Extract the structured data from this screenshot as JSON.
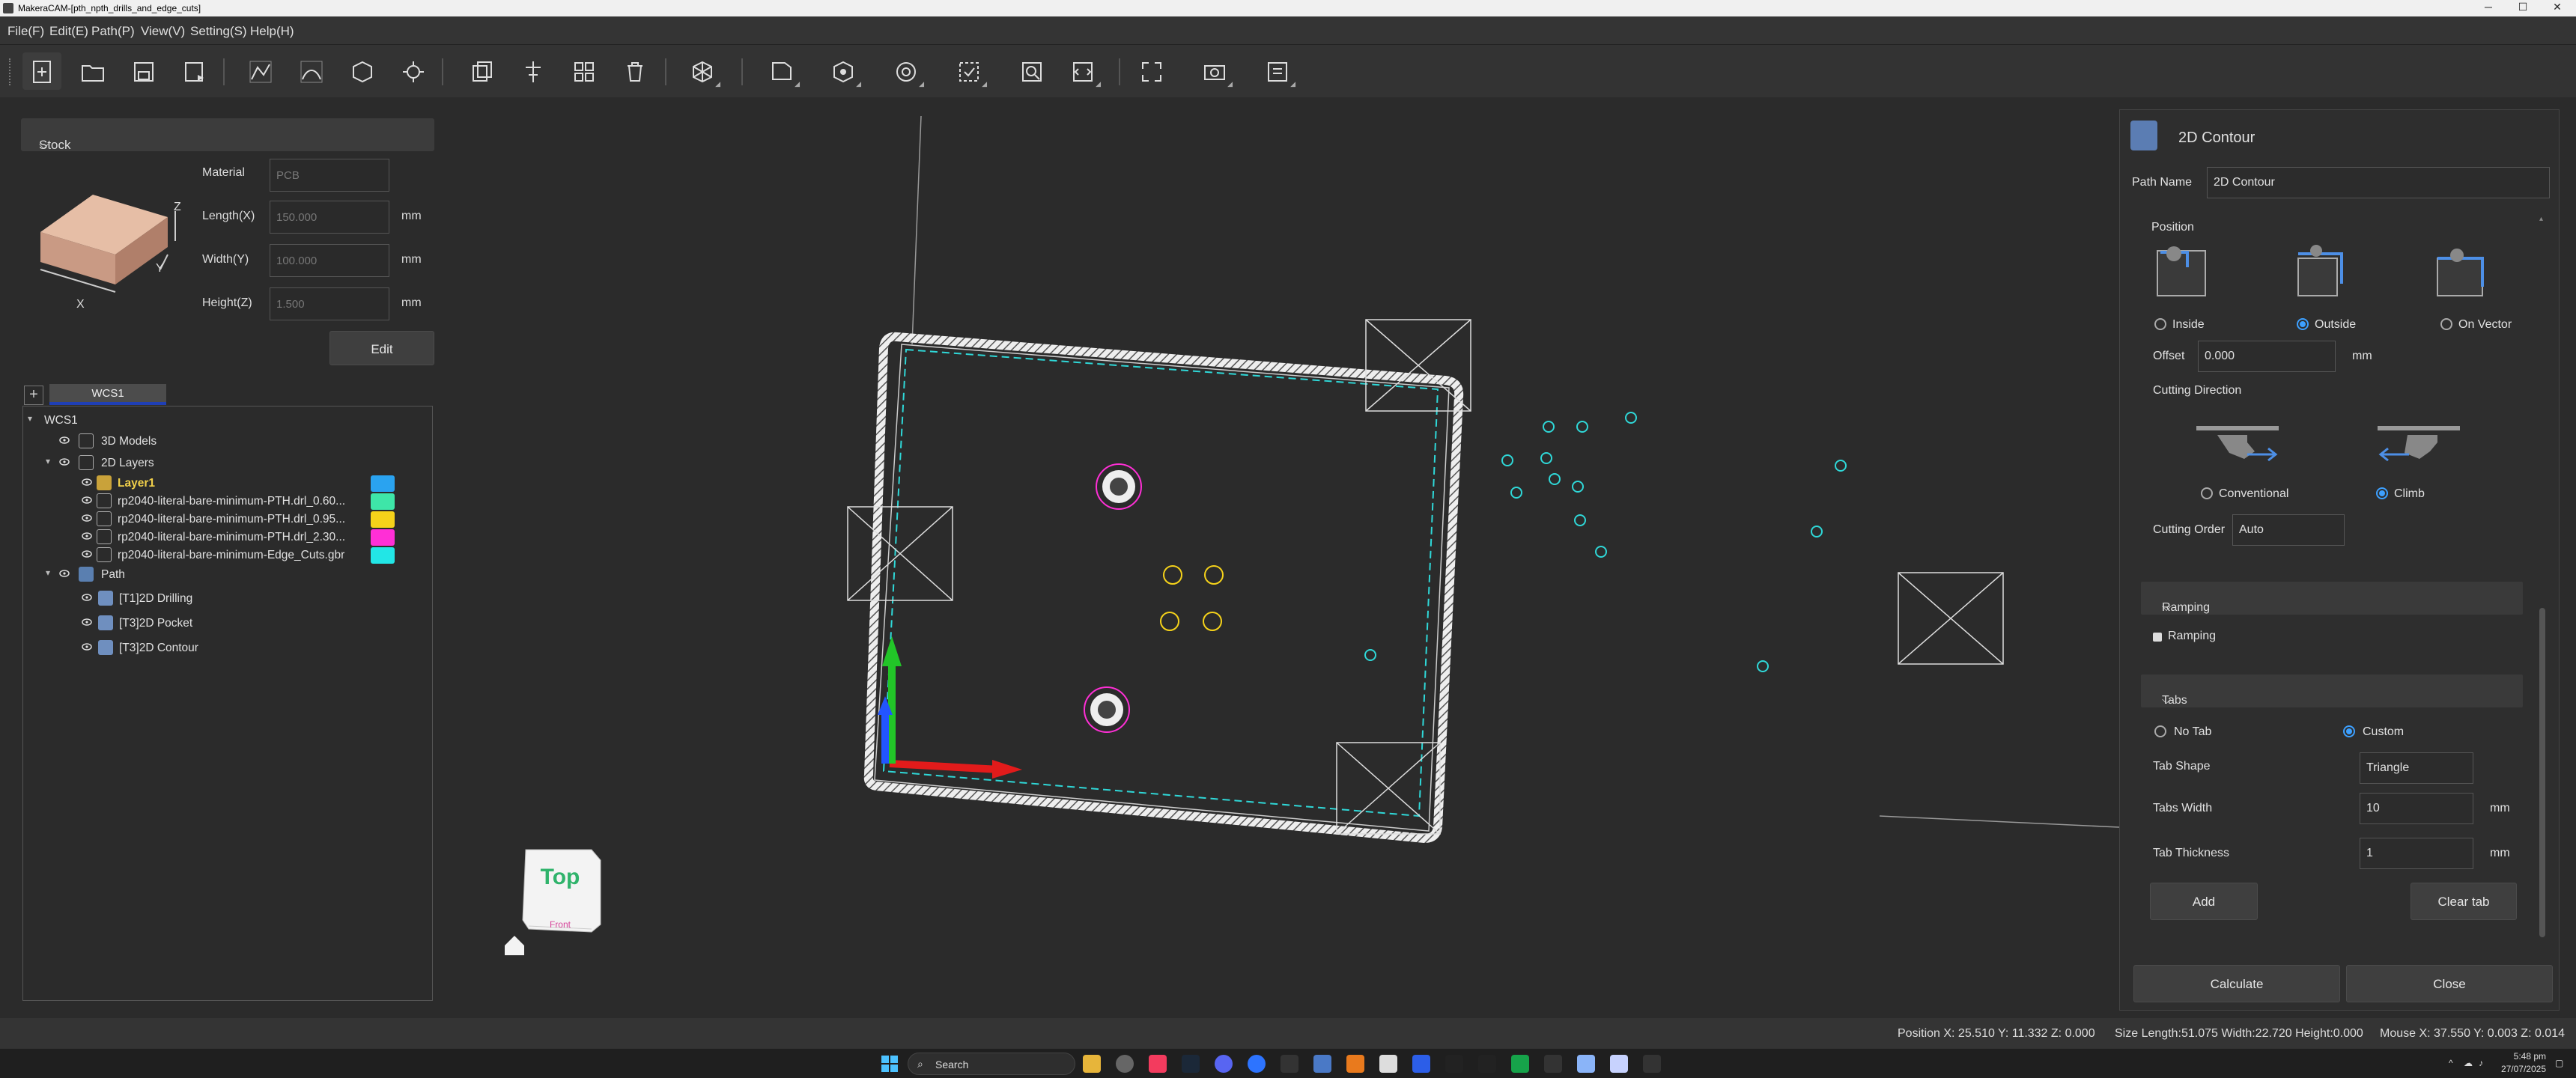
{
  "window": {
    "title": "MakeraCAM-[pth_npth_drills_and_edge_cuts]",
    "min": "─",
    "max": "☐",
    "close": "✕"
  },
  "menu": [
    "File(F)",
    "Edit(E)",
    "Path(P)",
    "View(V)",
    "Setting(S)",
    "Help(H)"
  ],
  "toolbar": [
    "new-file",
    "open-file",
    "save",
    "save-as",
    "import-2d",
    "import-3d",
    "import-model",
    "import-image",
    "copy",
    "align",
    "array",
    "delete",
    "transform",
    "stock",
    "wcs",
    "probe",
    "mark",
    "simulate",
    "gcode",
    "fit-view",
    "camera",
    "export"
  ],
  "stock": {
    "header": "Stock",
    "material_label": "Material",
    "material_value": "PCB",
    "length_label": "Length(X)",
    "length_value": "150.000",
    "width_label": "Width(Y)",
    "width_value": "100.000",
    "height_label": "Height(Z)",
    "height_value": "1.500",
    "unit": "mm",
    "edit_button": "Edit",
    "axis_x": "X",
    "axis_y": "Y",
    "axis_z": "Z"
  },
  "wcs_tab": "WCS1",
  "tree": {
    "root": "WCS1",
    "models": "3D Models",
    "layers": "2D Layers",
    "layer_items": [
      {
        "label": "Layer1",
        "color": "#2aa3f0"
      },
      {
        "label": "rp2040-literal-bare-minimum-PTH.drl_0.60...",
        "color": "#3ee6a8"
      },
      {
        "label": "rp2040-literal-bare-minimum-PTH.drl_0.95...",
        "color": "#f5d21a"
      },
      {
        "label": "rp2040-literal-bare-minimum-PTH.drl_2.30...",
        "color": "#ff2fd6"
      },
      {
        "label": "rp2040-literal-bare-minimum-Edge_Cuts.gbr",
        "color": "#22e6e6"
      }
    ],
    "path": "Path",
    "path_items": [
      "[T1]2D Drilling",
      "[T3]2D Pocket",
      "[T3]2D Contour"
    ]
  },
  "viewcube": {
    "label": "Top",
    "back": "Front"
  },
  "panel": {
    "title": "2D Contour",
    "path_name_label": "Path Name",
    "path_name_value": "2D Contour",
    "position_label": "Position",
    "positions": [
      "Inside",
      "Outside",
      "On Vector"
    ],
    "position_selected": "Outside",
    "offset_label": "Offset",
    "offset_value": "0.000",
    "offset_unit": "mm",
    "cutting_direction_label": "Cutting Direction",
    "directions": [
      "Conventional",
      "Climb"
    ],
    "direction_selected": "Climb",
    "cutting_order_label": "Cutting Order",
    "cutting_order_value": "Auto",
    "ramping_header": "Ramping",
    "ramping_check": "Ramping",
    "tabs_header": "Tabs",
    "tab_modes": [
      "No Tab",
      "Custom"
    ],
    "tab_mode_selected": "Custom",
    "tab_shape_label": "Tab Shape",
    "tab_shape_value": "Triangle",
    "tabs_width_label": "Tabs Width",
    "tabs_width_value": "10",
    "tab_thickness_label": "Tab Thickness",
    "tab_thickness_value": "1",
    "unit": "mm",
    "add_button": "Add",
    "clear_button": "Clear tab",
    "calculate_button": "Calculate",
    "close_button": "Close"
  },
  "status": {
    "position": "Position X: 25.510 Y: 11.332 Z: 0.000",
    "size": "Size Length:51.075 Width:22.720 Height:0.000",
    "mouse": "Mouse X: 37.550 Y: 0.003 Z: 0.014"
  },
  "taskbar": {
    "search": "Search",
    "time": "5:48 pm",
    "date": "27/07/2025"
  }
}
